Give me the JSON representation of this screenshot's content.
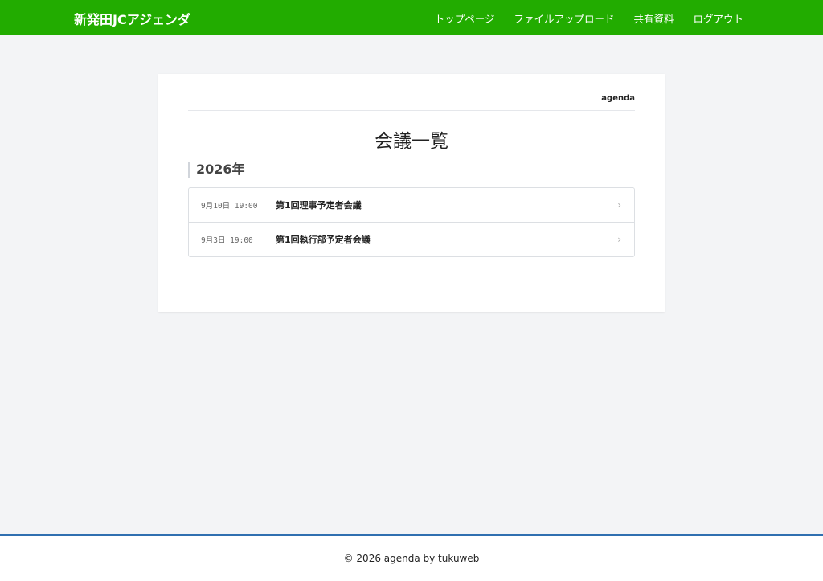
{
  "navbar": {
    "brand": "新発田JCアジェンダ",
    "links": [
      {
        "label": "トップページ"
      },
      {
        "label": "ファイルアップロード"
      },
      {
        "label": "共有資料"
      },
      {
        "label": "ログアウト"
      }
    ],
    "color": "#22ac00"
  },
  "breadcrumb": {
    "label": "agenda"
  },
  "main": {
    "title": "会議一覧",
    "year_heading": "2026年",
    "meetings": [
      {
        "date": "9月10日 19:00",
        "name": "第1回理事予定者会議",
        "chevron": "›"
      },
      {
        "date": "9月3日  19:00",
        "name": "第1回執行部予定者会議",
        "chevron": "›"
      }
    ]
  },
  "footer": {
    "copyright": "© 2026 agenda by tukuweb",
    "accent": "#2f6fb0"
  }
}
